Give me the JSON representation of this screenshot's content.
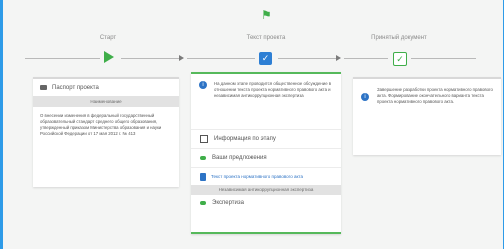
{
  "stages": [
    {
      "label": "Старт"
    },
    {
      "label": "Текст проекта"
    },
    {
      "label": "Принятый документ"
    }
  ],
  "left_card": {
    "title": "Паспорт проекта",
    "band": "Наименование",
    "description": "О внесении изменения в федеральный государственный образовательный стандарт среднего общего образования, утвержденный приказом Министерства образования и науки Российской Федерации от 17 мая 2012 г. № 413"
  },
  "middle_card": {
    "info": "На данном этапе проводится общественное обсуждение в отношении текста проекта нормативного правового акта и независимая антикоррупционная экспертиза",
    "stage_info": "Информация по этапу",
    "suggestions": "Ваши предложения",
    "document_link": "Текст проекта нормативного правового акта",
    "band": "Независимая антикоррупционная экспертиза",
    "expertise": "Экспертиза"
  },
  "right_card": {
    "info": "Завершение разработки проекта нормативного правового акта. Формирование окончательного варианта текста проекта нормативного правового акта."
  },
  "colors": {
    "background": "#2e9be8",
    "accent_green": "#3fae49",
    "accent_blue": "#2d73c5"
  }
}
